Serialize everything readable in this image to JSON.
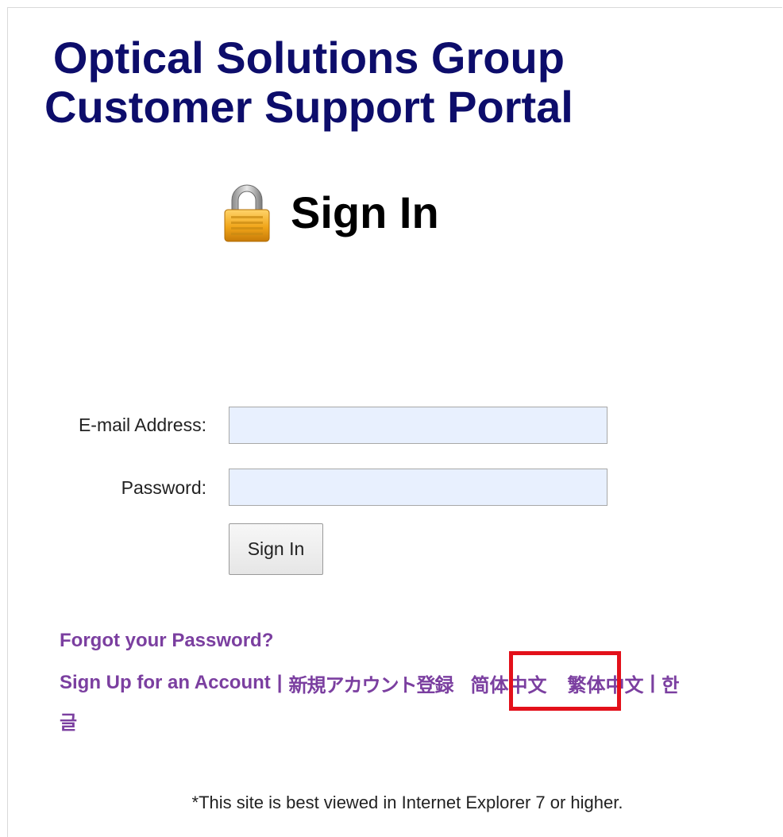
{
  "header": {
    "title_line1": "Optical Solutions Group",
    "title_line2": "Customer Support Portal"
  },
  "signin": {
    "heading": "Sign In",
    "icon": "padlock-icon"
  },
  "form": {
    "email_label": "E-mail Address:",
    "email_value": "",
    "password_label": "Password:",
    "password_value": "",
    "submit_label": "Sign In"
  },
  "links": {
    "forgot_password": "Forgot your Password?",
    "sign_up": "Sign Up for an Account",
    "separator": "|",
    "japanese_signup": "新規アカウント登録",
    "simplified_chinese": "简体中文",
    "traditional_chinese": "繁体中文",
    "korean_part1": "한",
    "korean_part2": "글"
  },
  "footer": {
    "note": "*This site is best viewed in Internet Explorer 7 or higher."
  },
  "colors": {
    "title": "#0d0d6b",
    "link": "#7b3fa0",
    "highlight": "#e3101a",
    "input_bg": "#e8f0fe"
  }
}
